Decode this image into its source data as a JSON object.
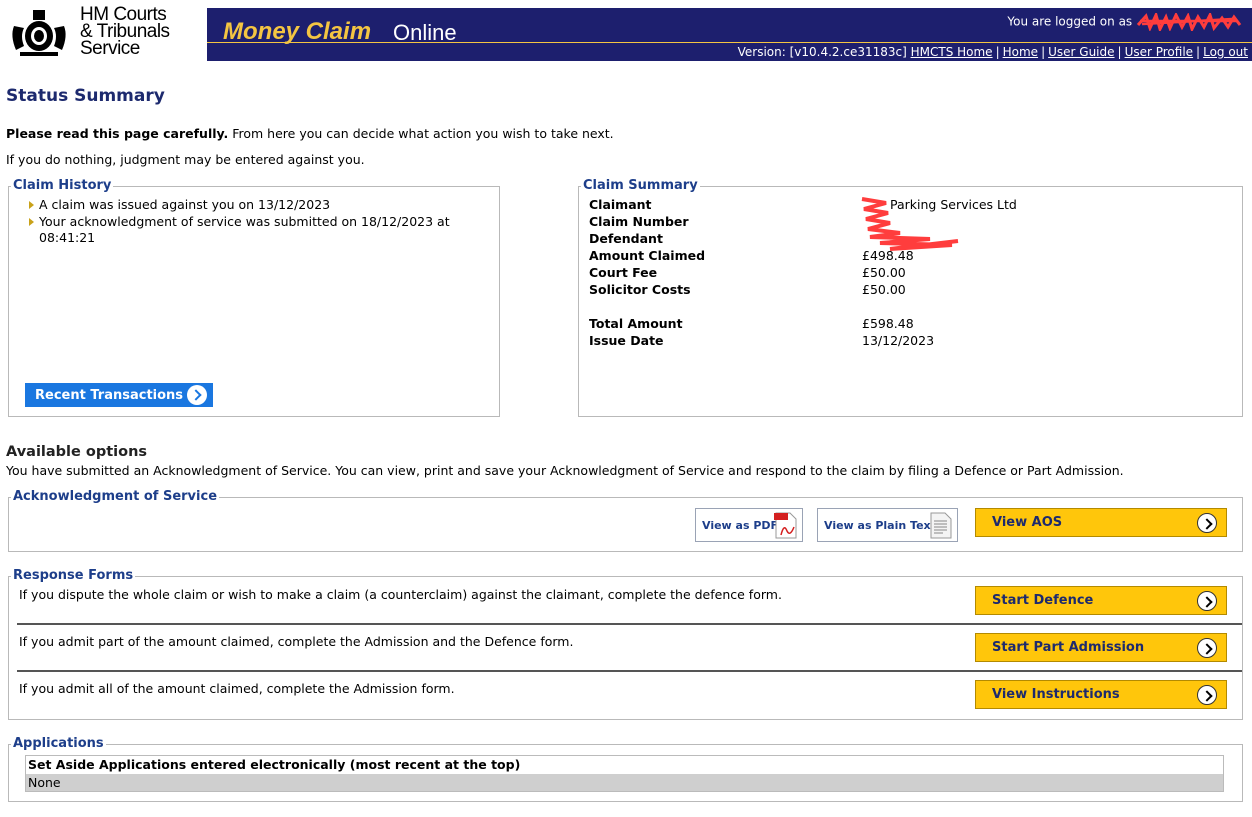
{
  "header": {
    "logo_lines": [
      "HM Courts",
      "& Tribunals",
      "Service"
    ],
    "brand_money": "Money Claim",
    "brand_online": "Online",
    "logged_in_text": "You are logged on as",
    "version": "Version: [v10.4.2.ce31183c]",
    "links": [
      "HMCTS Home",
      "Home",
      "User Guide",
      "User Profile",
      "Log out"
    ],
    "brand_color": "#1d1f6e",
    "accent_color": "#f4c542"
  },
  "page": {
    "title": "Status Summary",
    "intro_bold": "Please read this page carefully.",
    "intro_rest": " From here you can decide what action you wish to take next.",
    "warning": "If you do nothing, judgment may be entered against you."
  },
  "claim_history": {
    "legend": "Claim History",
    "items": [
      "A claim was issued against you on 13/12/2023",
      "Your acknowledgment of service was submitted on 18/12/2023 at 08:41:21"
    ],
    "button_label": "Recent Transactions"
  },
  "claim_summary": {
    "legend": "Claim Summary",
    "rows": [
      {
        "label": "Claimant",
        "value": "Parking Services Ltd"
      },
      {
        "label": "Claim Number",
        "value": ""
      },
      {
        "label": "Defendant",
        "value": ""
      },
      {
        "label": "Amount Claimed",
        "value": "£498.48"
      },
      {
        "label": "Court Fee",
        "value": "£50.00"
      },
      {
        "label": "Solicitor Costs",
        "value": "£50.00"
      },
      {
        "label": "Total Amount",
        "value": "£598.48"
      },
      {
        "label": "Issue Date",
        "value": "13/12/2023"
      }
    ]
  },
  "available_options": {
    "heading": "Available options",
    "text": "You have submitted an Acknowledgment of Service. You can view, print and save your Acknowledgment of Service and respond to the claim by filing a Defence or Part Admission."
  },
  "aos": {
    "legend": "Acknowledgment of Service",
    "view_pdf": "View as PDF",
    "view_text": "View as Plain Text",
    "view_aos": "View AOS"
  },
  "response_forms": {
    "legend": "Response Forms",
    "rows": [
      {
        "text": "If you dispute the whole claim or wish to make a claim (a counterclaim) against the claimant, complete the defence form.",
        "button": "Start Defence"
      },
      {
        "text": "If you admit part of the amount claimed, complete the Admission and the Defence form.",
        "button": "Start Part Admission"
      },
      {
        "text": "If you admit all of the amount claimed, complete the Admission form.",
        "button": "View Instructions"
      }
    ]
  },
  "applications": {
    "legend": "Applications",
    "table_header": "Set Aside Applications entered electronically (most recent at the top)",
    "row": "None"
  }
}
